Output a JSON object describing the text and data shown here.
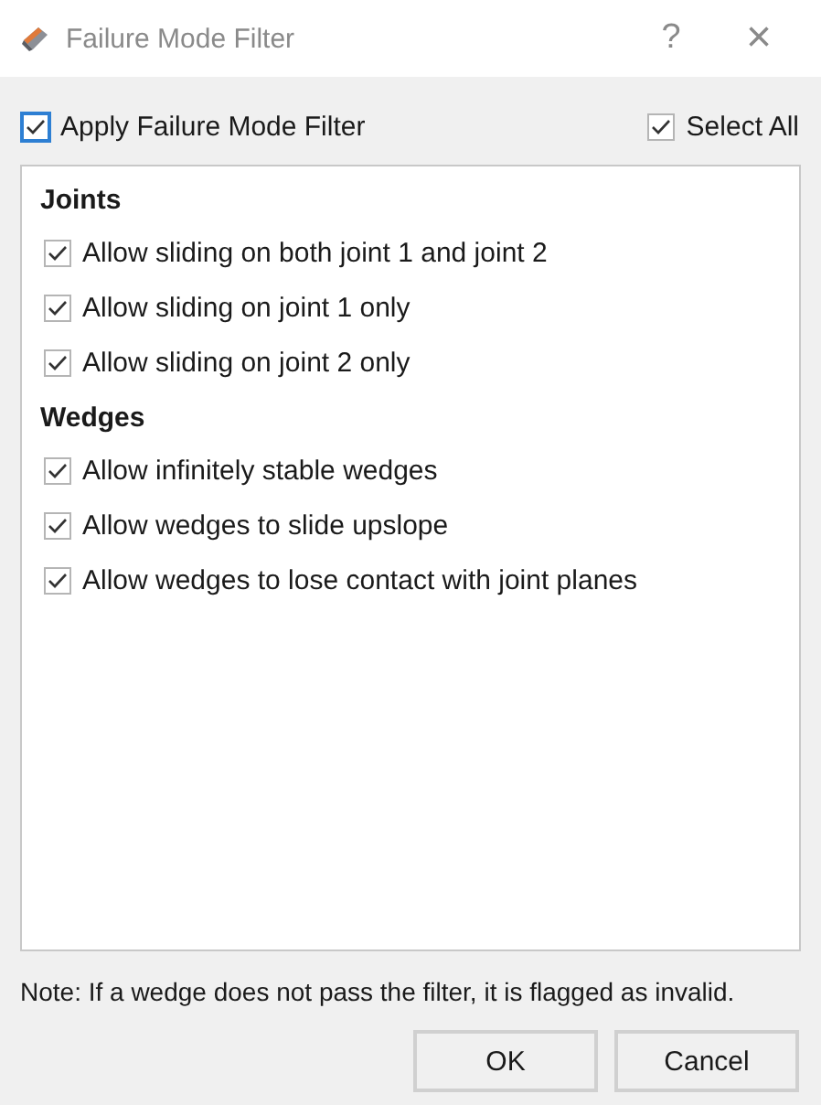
{
  "window": {
    "title": "Failure Mode Filter",
    "help": "?",
    "close": "×"
  },
  "apply_filter": {
    "label": "Apply Failure Mode Filter",
    "checked": true,
    "focused": true
  },
  "select_all": {
    "label": "Select All",
    "checked": true,
    "focused": false
  },
  "groups": [
    {
      "heading": "Joints",
      "options": [
        {
          "label": "Allow sliding on both joint 1 and joint 2",
          "checked": true
        },
        {
          "label": "Allow sliding on joint 1 only",
          "checked": true
        },
        {
          "label": "Allow sliding on joint 2 only",
          "checked": true
        }
      ]
    },
    {
      "heading": "Wedges",
      "options": [
        {
          "label": "Allow infinitely stable wedges",
          "checked": true
        },
        {
          "label": "Allow wedges to slide upslope",
          "checked": true
        },
        {
          "label": "Allow wedges to lose contact with joint planes",
          "checked": true
        }
      ]
    }
  ],
  "note": "Note: If a wedge does not pass the filter, it is flagged as invalid.",
  "buttons": [
    "OK",
    "Cancel"
  ]
}
